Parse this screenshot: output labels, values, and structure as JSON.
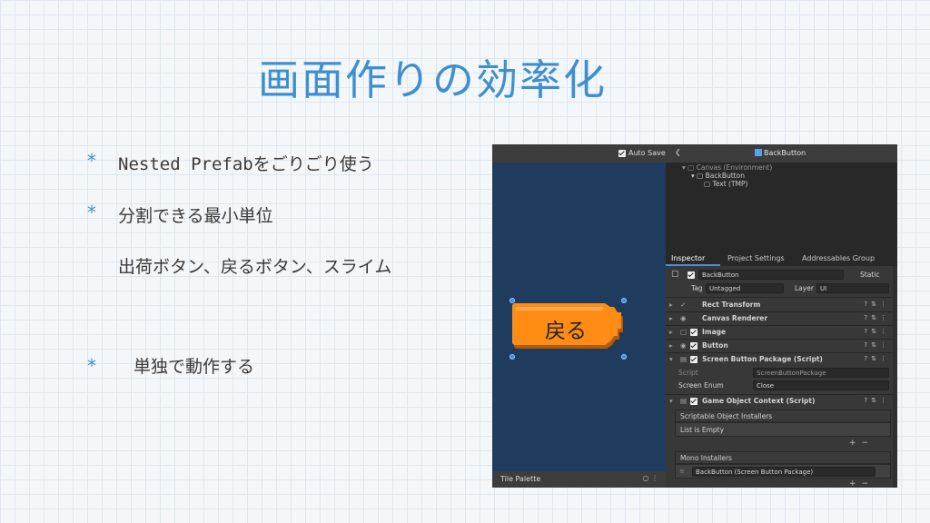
{
  "title": "画面作りの効率化",
  "bullets": [
    {
      "marker": "*",
      "text": "Nested Prefabをごりごり使う"
    },
    {
      "marker": "*",
      "text": "分割できる最小単位"
    },
    {
      "marker": "",
      "text": "出荷ボタン、戻るボタン、スライム"
    },
    {
      "marker": "*",
      "text": "単独で動作する"
    }
  ],
  "unity": {
    "scene": {
      "auto_save": "Auto Save",
      "button_label": "戻る",
      "button_color": "#ff8c14",
      "tile_palette": "Tile Palette",
      "background": "#1f3c5e"
    },
    "hierarchy": {
      "title": "BackButton",
      "rows": [
        "Canvas (Environment)",
        "BackButton",
        "Text (TMP)"
      ]
    },
    "inspector": {
      "tabs": [
        "Inspector",
        "Project Settings",
        "Addressables Group"
      ],
      "object_name": "BackButton",
      "static_label": "Static",
      "tag_label": "Tag",
      "tag_value": "Untagged",
      "layer_label": "Layer",
      "layer_value": "UI",
      "components": [
        "Rect Transform",
        "Canvas Renderer",
        "Image",
        "Button",
        "Screen Button Package (Script)"
      ],
      "script_label": "Script",
      "script_value": "ScreenButtonPackage",
      "screen_enum_label": "Screen Enum",
      "screen_enum_value": "Close",
      "context_component": "Game Object Context (Script)",
      "scriptable_installers": "Scriptable Object Installers",
      "list_empty": "List is Empty",
      "mono_installers": "Mono Installers",
      "mono_item": "BackButton (Screen Button Package)"
    }
  }
}
